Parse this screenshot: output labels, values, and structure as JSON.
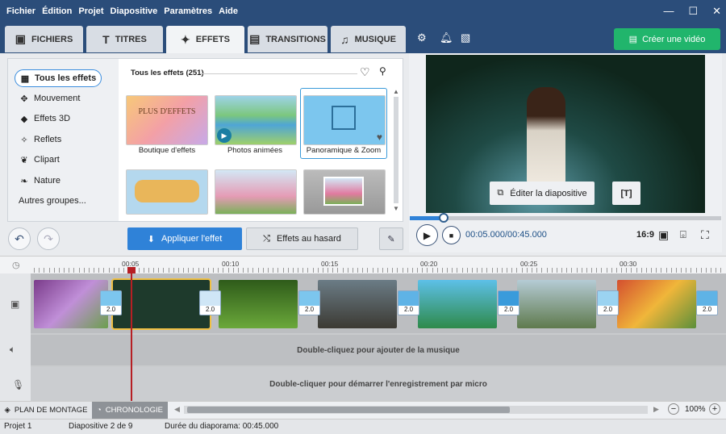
{
  "menu": [
    "Fichier",
    "Édition",
    "Projet",
    "Diapositive",
    "Paramètres",
    "Aide"
  ],
  "tabs": [
    {
      "label": "FICHIERS",
      "icon": "add-photo-icon"
    },
    {
      "label": "TITRES",
      "icon": "text-icon"
    },
    {
      "label": "EFFETS",
      "icon": "star-effects-icon"
    },
    {
      "label": "TRANSITIONS",
      "icon": "transitions-icon"
    },
    {
      "label": "MUSIQUE",
      "icon": "music-icon"
    }
  ],
  "create_button": "Créer une vidéo",
  "sidebar": [
    {
      "label": "Tous les effets",
      "icon": "grid-icon"
    },
    {
      "label": "Mouvement",
      "icon": "motion-icon"
    },
    {
      "label": "Effets 3D",
      "icon": "cube-icon"
    },
    {
      "label": "Reflets",
      "icon": "sparkle-icon"
    },
    {
      "label": "Clipart",
      "icon": "clipart-icon"
    },
    {
      "label": "Nature",
      "icon": "leaf-icon"
    },
    {
      "label": "Autres groupes...",
      "icon": ""
    }
  ],
  "effects_header": "Tous les effets (251)",
  "effects": [
    {
      "label": "Boutique d'effets",
      "badge": "PLUS D'EFFETS"
    },
    {
      "label": "Photos animées"
    },
    {
      "label": "Panoramique & Zoom"
    }
  ],
  "apply_button": "Appliquer l'effet",
  "random_button": "Effets au hasard",
  "preview": {
    "edit_slide": "Éditer la diapositive",
    "time_current": "00:05.000",
    "time_total": "/00:45.000",
    "ratio": "16:9",
    "progress": 0.11
  },
  "timeline_labels": [
    "00:05",
    "00:10",
    "00:15",
    "00:20",
    "00:25",
    "00:30"
  ],
  "transition_duration": "2.0",
  "music_track_hint": "Double-cliquez pour ajouter de la musique",
  "mic_track_hint": "Double-cliquer pour démarrer l'enregistrement par micro",
  "bottom_tabs": [
    "PLAN DE MONTAGE",
    "CHRONOLOGIE"
  ],
  "zoom": "100%",
  "status": {
    "project": "Projet 1",
    "slide": "Diapositive 2 de 9",
    "duration": "Durée du diaporama: 00:45.000"
  },
  "colors": {
    "accent": "#2b4d7a",
    "green": "#21b56c",
    "blue": "#2f82d8",
    "playhead": "#b61f24"
  }
}
